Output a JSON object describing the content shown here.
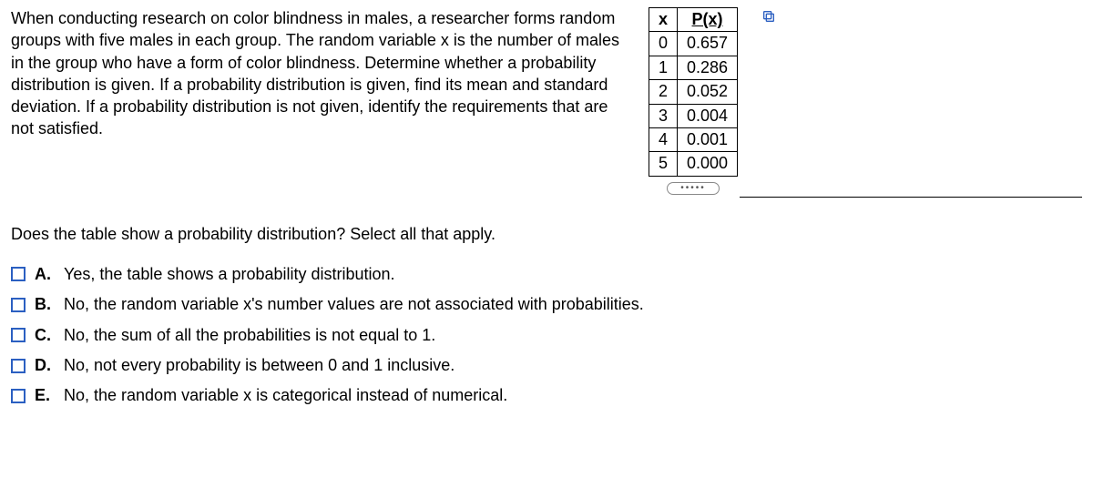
{
  "problem": {
    "text": "When conducting research on color blindness in males, a researcher forms random groups with five males in each group. The random variable x is the number of males in the group who have a form of color blindness. Determine whether a probability distribution is given. If a probability distribution is given, find its mean and standard deviation. If a probability distribution is not given, identify the requirements that are not satisfied."
  },
  "table": {
    "headers": {
      "x": "x",
      "px": "P(x)"
    },
    "rows": [
      {
        "x": "0",
        "px": "0.657"
      },
      {
        "x": "1",
        "px": "0.286"
      },
      {
        "x": "2",
        "px": "0.052"
      },
      {
        "x": "3",
        "px": "0.004"
      },
      {
        "x": "4",
        "px": "0.001"
      },
      {
        "x": "5",
        "px": "0.000"
      }
    ]
  },
  "question": {
    "prompt": "Does the table show a probability distribution? Select all that apply.",
    "options": [
      {
        "letter": "A.",
        "text": "Yes, the table shows a probability distribution."
      },
      {
        "letter": "B.",
        "text": "No, the random variable x's number values are not associated with probabilities."
      },
      {
        "letter": "C.",
        "text": "No, the sum of all the probabilities is not equal to 1."
      },
      {
        "letter": "D.",
        "text": "No, not every probability is between 0 and 1 inclusive."
      },
      {
        "letter": "E.",
        "text": "No, the random variable x is categorical instead of numerical."
      }
    ]
  }
}
